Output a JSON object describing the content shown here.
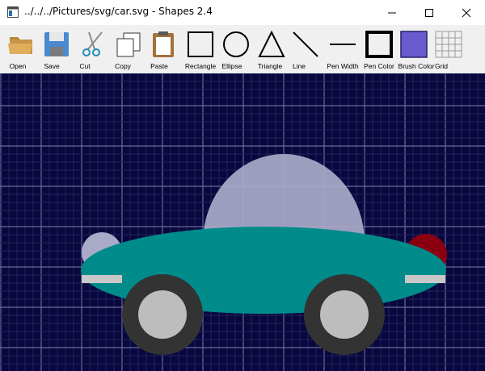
{
  "window": {
    "title": "../../../Pictures/svg/car.svg - Shapes 2.4",
    "controls": [
      "minimize",
      "maximize",
      "close"
    ]
  },
  "toolbar": {
    "tools": [
      {
        "id": "open",
        "label": "Open",
        "icon": "folder-open-icon"
      },
      {
        "id": "save",
        "label": "Save",
        "icon": "floppy-disk-icon"
      },
      {
        "id": "cut",
        "label": "Cut",
        "icon": "scissors-icon"
      },
      {
        "id": "copy",
        "label": "Copy",
        "icon": "copy-icon"
      },
      {
        "id": "paste",
        "label": "Paste",
        "icon": "clipboard-icon"
      },
      {
        "id": "rectangle",
        "label": "Rectangle",
        "icon": "rectangle-icon"
      },
      {
        "id": "ellipse",
        "label": "Ellipse",
        "icon": "ellipse-icon"
      },
      {
        "id": "triangle",
        "label": "Triangle",
        "icon": "triangle-icon"
      },
      {
        "id": "line",
        "label": "Line",
        "icon": "line-icon"
      },
      {
        "id": "pen_width",
        "label": "Pen Width",
        "icon": "pen-width-icon"
      },
      {
        "id": "pen_color",
        "label": "Pen Color",
        "icon": "pen-color-icon",
        "color": "#000000"
      },
      {
        "id": "brush_color",
        "label": "Brush Color",
        "icon": "brush-color-icon",
        "color": "#6a5acd"
      },
      {
        "id": "grid",
        "label": "Grid",
        "icon": "grid-icon"
      }
    ]
  },
  "canvas": {
    "background": "#08083f",
    "grid": true,
    "colors": {
      "grid_major": "#6a6a9a",
      "grid_minor": "#24245e",
      "dome": "#a9a9c8",
      "body": "#008b8b",
      "headlight": "#a9a9c8",
      "taillight": "#8b0010",
      "bumper": "#c8c8c8",
      "tire": "#333333",
      "hubcap": "#bdbdbd"
    }
  }
}
